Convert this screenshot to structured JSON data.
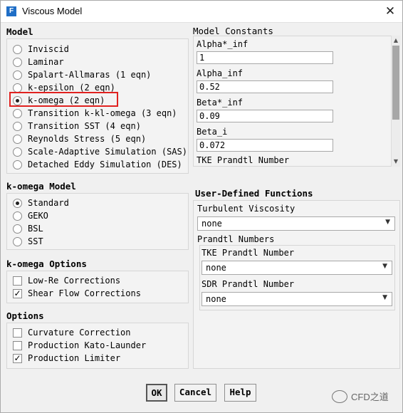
{
  "window": {
    "title": "Viscous Model",
    "icon_letter": "F",
    "close_glyph": "✕"
  },
  "model": {
    "heading": "Model",
    "options": [
      {
        "label": "Inviscid",
        "selected": false
      },
      {
        "label": "Laminar",
        "selected": false
      },
      {
        "label": "Spalart-Allmaras (1 eqn)",
        "selected": false
      },
      {
        "label": "k-epsilon (2 eqn)",
        "selected": false
      },
      {
        "label": "k-omega (2 eqn)",
        "selected": true
      },
      {
        "label": "Transition k-kl-omega (3 eqn)",
        "selected": false
      },
      {
        "label": "Transition SST (4 eqn)",
        "selected": false
      },
      {
        "label": "Reynolds Stress (5 eqn)",
        "selected": false
      },
      {
        "label": "Scale-Adaptive Simulation (SAS)",
        "selected": false
      },
      {
        "label": "Detached Eddy Simulation (DES)",
        "selected": false
      }
    ]
  },
  "kw_model": {
    "heading": "k-omega Model",
    "options": [
      {
        "label": "Standard",
        "selected": true
      },
      {
        "label": "GEKO",
        "selected": false
      },
      {
        "label": "BSL",
        "selected": false
      },
      {
        "label": "SST",
        "selected": false
      }
    ]
  },
  "kw_options": {
    "heading": "k-omega Options",
    "items": [
      {
        "label": "Low-Re Corrections",
        "checked": false
      },
      {
        "label": "Shear Flow Corrections",
        "checked": true
      }
    ]
  },
  "options": {
    "heading": "Options",
    "items": [
      {
        "label": "Curvature Correction",
        "checked": false
      },
      {
        "label": "Production Kato-Launder",
        "checked": false
      },
      {
        "label": "Production Limiter",
        "checked": true
      }
    ]
  },
  "constants": {
    "heading": "Model Constants",
    "fields": [
      {
        "label": "Alpha*_inf",
        "value": "1"
      },
      {
        "label": "Alpha_inf",
        "value": "0.52"
      },
      {
        "label": "Beta*_inf",
        "value": "0.09"
      },
      {
        "label": "Beta_i",
        "value": "0.072"
      }
    ],
    "partial_label": "TKE Prandtl Number"
  },
  "udf": {
    "heading": "User-Defined Functions",
    "turb_visc_label": "Turbulent Viscosity",
    "turb_visc_value": "none",
    "prandtl_heading": "Prandtl Numbers",
    "tke_label": "TKE Prandtl Number",
    "tke_value": "none",
    "sdr_label": "SDR Prandtl Number",
    "sdr_value": "none"
  },
  "buttons": {
    "ok": "OK",
    "cancel": "Cancel",
    "help": "Help"
  },
  "watermark": {
    "text": "CFD之道"
  },
  "colors": {
    "highlight": "#e0211f",
    "app_icon": "#1f6ec6"
  }
}
